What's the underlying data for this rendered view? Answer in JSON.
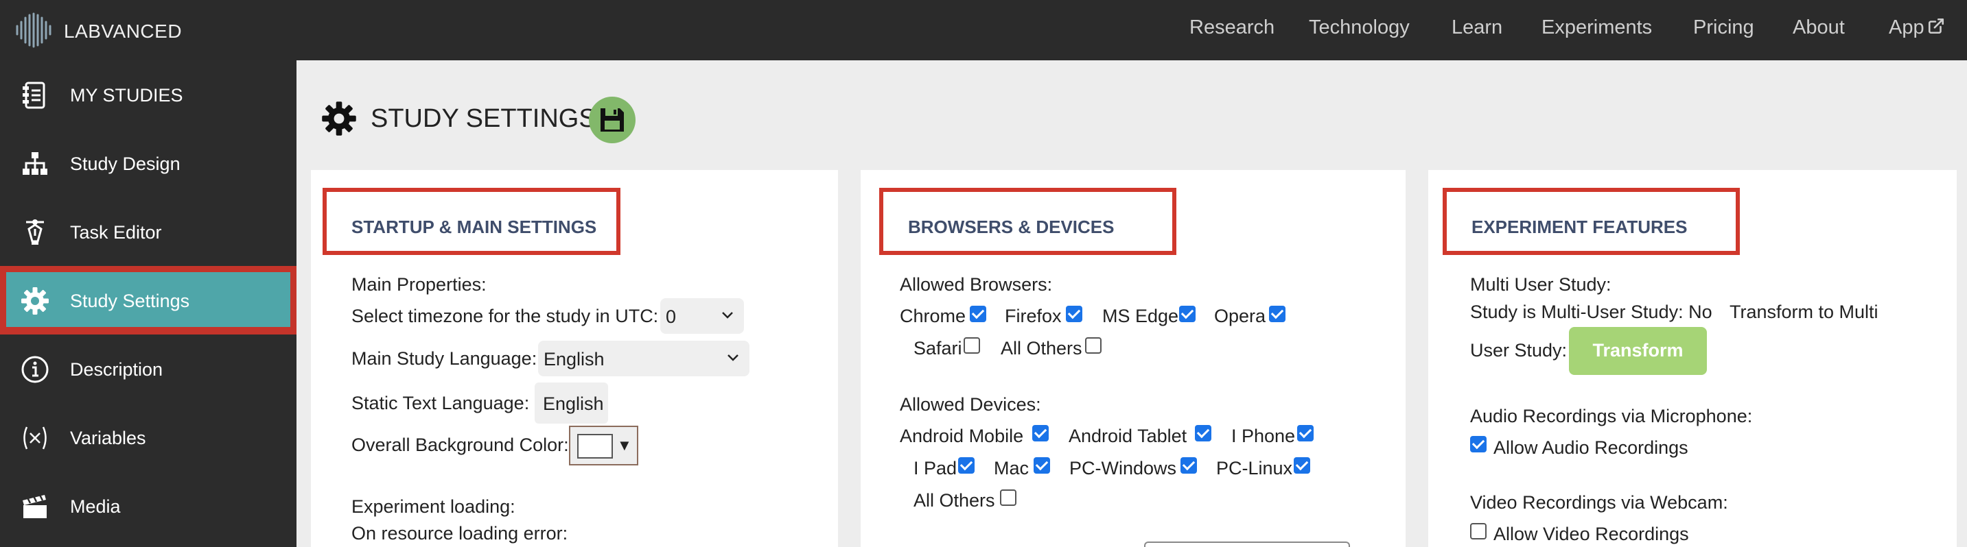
{
  "brand": {
    "name": "LABVANCED",
    "logo_icon": "labvanced-logo-icon"
  },
  "top_nav": [
    {
      "label": "Research"
    },
    {
      "label": "Technology"
    },
    {
      "label": "Learn"
    },
    {
      "label": "Experiments"
    },
    {
      "label": "Pricing"
    },
    {
      "label": "About"
    },
    {
      "label": "App",
      "icon": "external-link-icon"
    }
  ],
  "sidebar": {
    "items": [
      {
        "label": "MY STUDIES",
        "icon": "studies-list-icon"
      },
      {
        "label": "Study Design",
        "icon": "hierarchy-icon"
      },
      {
        "label": "Task Editor",
        "icon": "pen-nib-icon"
      },
      {
        "label": "Study Settings",
        "icon": "gear-icon",
        "active": true
      },
      {
        "label": "Description",
        "icon": "info-icon"
      },
      {
        "label": "Variables",
        "icon": "variable-x-icon"
      },
      {
        "label": "Media",
        "icon": "clapperboard-icon"
      }
    ]
  },
  "header": {
    "title": "STUDY SETTINGS",
    "save_icon": "floppy-disk-icon"
  },
  "startup": {
    "title": "STARTUP & MAIN SETTINGS",
    "main_properties_label": "Main Properties:",
    "timezone_label": "Select timezone for the study in UTC:",
    "timezone_value": "0",
    "language_label": "Main Study Language:",
    "language_value": "English",
    "static_text_label": "Static Text Language:",
    "static_text_value": "English",
    "bg_color_label": "Overall Background Color:",
    "bg_color_value": "#ffffff",
    "experiment_loading_label": "Experiment loading:",
    "resource_error_label": "On resource loading error:"
  },
  "browsers": {
    "title": "BROWSERS & DEVICES",
    "allowed_browsers_label": "Allowed Browsers:",
    "browsers": [
      {
        "label": "Chrome",
        "checked": true
      },
      {
        "label": "Firefox",
        "checked": true
      },
      {
        "label": "MS Edge",
        "checked": true
      },
      {
        "label": "Opera",
        "checked": true
      },
      {
        "label": "Safari",
        "checked": false
      },
      {
        "label": "All Others",
        "checked": false
      }
    ],
    "allowed_devices_label": "Allowed Devices:",
    "devices": [
      {
        "label": "Android Mobile",
        "checked": true
      },
      {
        "label": "Android Tablet",
        "checked": true
      },
      {
        "label": "I Phone",
        "checked": true
      },
      {
        "label": "I Pad",
        "checked": true
      },
      {
        "label": "Mac",
        "checked": true
      },
      {
        "label": "PC-Windows",
        "checked": true
      },
      {
        "label": "PC-Linux",
        "checked": true
      },
      {
        "label": "All Others",
        "checked": false
      }
    ]
  },
  "features": {
    "title": "EXPERIMENT FEATURES",
    "multi_user_label": "Multi User Study:",
    "multi_user_status": "Study is Multi-User Study: No",
    "transform_label_1": "Transform to Multi",
    "transform_label_2": "User Study:",
    "transform_button": "Transform",
    "audio_label": "Audio Recordings via Microphone:",
    "audio_option": "Allow Audio Recordings",
    "audio_checked": true,
    "video_label": "Video Recordings via Webcam:",
    "video_option": "Allow Video Recordings",
    "video_checked": false
  },
  "colors": {
    "topbar": "#2b2b2b",
    "sidebar": "#2c2c2c",
    "active_item": "#4fa6a9",
    "highlight_border": "#d0382c",
    "section_title": "#3f4d6b",
    "save_button": "#82b86a",
    "transform_button": "#a6d476",
    "checkbox_on": "#1a73e8"
  }
}
